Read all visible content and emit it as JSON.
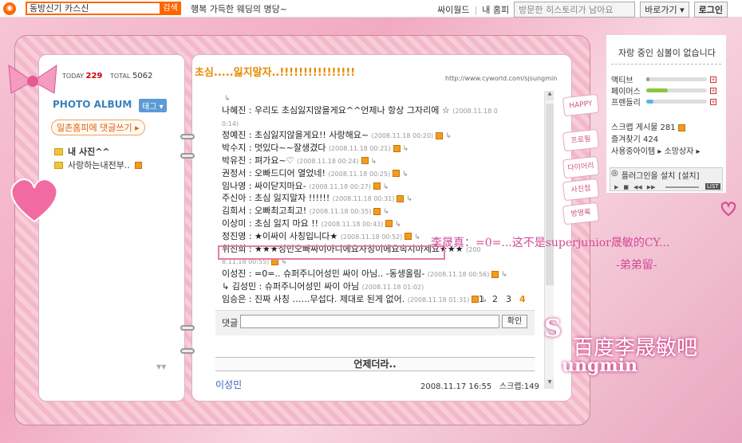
{
  "topbar": {
    "search_value": "동방신기 카스신",
    "search_button": "검색",
    "ticker": "행복 가득한 웨딩의 명당~",
    "links": [
      "싸이월드",
      "내 홈피"
    ],
    "history_placeholder": "방문한 히스토리가 남아요",
    "shortcut": "바로가기 ▾",
    "login": "로그인"
  },
  "counter": {
    "today_label": "TODAY",
    "today": "229",
    "total_label": "TOTAL",
    "total": "5062"
  },
  "left": {
    "album_title": "PHOTO ALBUM",
    "tag_button": "태그 ▾",
    "ilchon_link": "일촌홈피에 댓글쓰기 ▸",
    "folders": [
      "내 사진^^",
      "사랑하는내전부.."
    ]
  },
  "post": {
    "title": "초심.....잃지말자..!!!!!!!!!!!!!!!!",
    "url": "http://www.cyworld.com/sjsungmin",
    "comments": [
      {
        "text": "",
        "date": "",
        "reply": "↳"
      },
      {
        "text": "나혜진 : 우리도 초심잃지않을게요^^언제나 항상 그자리에 ☆",
        "date": "(2008.11.18 0",
        "reply": ""
      },
      {
        "text": "",
        "date": "0:14)",
        "reply": ""
      },
      {
        "text": "정예진 : 초심잃지않을게요!! 사랑해요~",
        "date": "(2008.11.18 00:20)",
        "reply": "↳"
      },
      {
        "text": "박수지 : 멋있다~~잘생겼다",
        "date": "(2008.11.18 00:21)",
        "reply": "↳"
      },
      {
        "text": "박유진 : 펴가요~♡",
        "date": "(2008.11.18 00:24)",
        "reply": "↳"
      },
      {
        "text": "권정서 : 오빠드디어 열었네!",
        "date": "(2008.11.18 00:25)",
        "reply": "↳"
      },
      {
        "text": "임나영 : 싸이닫지마요-",
        "date": "(2008.11.18 00:27)",
        "reply": "↳"
      },
      {
        "text": "주신아 : 초심 잃지말자 !!!!!!",
        "date": "(2008.11.18 00:31)",
        "reply": "↳"
      },
      {
        "text": "김희서 : 오빠최고최고!",
        "date": "(2008.11.18 00:35)",
        "reply": "↳"
      },
      {
        "text": "이상미 : 초심 잃지 마요 !!",
        "date": "(2008.11.18 00:43)",
        "reply": "↳"
      },
      {
        "text": "정진영 : ★이싸이 사칭입니다★",
        "date": "(2008.11.18 00:52)",
        "reply": "↳"
      },
      {
        "text": "위진희 : ★★★성민오빠싸이아니에요사칭이에요속지마세요★★★",
        "date": "(200",
        "reply": ""
      },
      {
        "text": "",
        "date": "8.11.18 00:55)",
        "reply": "↳"
      },
      {
        "text": "이성진 : =0=.. 슈퍼주니어성민 싸이 아님.. -동생올림-",
        "date": "(2008.11.18 00:56)",
        "reply": "↳"
      },
      {
        "text": "    ↳ 김성민 : 슈퍼주니어성민 싸이 아님",
        "date": "(2008.11.18 01:02)",
        "reply": ""
      },
      {
        "text": "임승은 : 진짜 사칭 ……무섭다. 제대로 된게 없어.",
        "date": "(2008.11.18 01:31)",
        "reply": "↳"
      }
    ],
    "pages": [
      "1",
      "2",
      "3",
      "4"
    ],
    "current_page": "4",
    "reply_label": "댓글",
    "reply_button": "확인",
    "section_title": "언제더라..",
    "author": "이성민",
    "meta_date": "2008.11.17 16:55",
    "scrap": "스크랩:149"
  },
  "side_tabs": [
    "HAPPY",
    "프로필",
    "다이어리",
    "사진첩",
    "방명록"
  ],
  "sidebar": {
    "title": "자랑 중인 심볼이 없습니다",
    "meters": [
      {
        "label": "액티브",
        "value": 0.05,
        "color": "#999999"
      },
      {
        "label": "페이머스",
        "value": 0.35,
        "color": "#8ec63f"
      },
      {
        "label": "프렌들리",
        "value": 0.12,
        "color": "#5ab4e6"
      }
    ],
    "scrap_count": "스크랩 게시물 281",
    "favorite": "즐겨찾기 424",
    "items": "사용중아이템 ▸ 소망상자 ▸",
    "player": "플러그인을 설치",
    "install": "[설치]",
    "list": "LIST"
  },
  "overlay": {
    "line1": "李晟真：=0=...这不是superjunior晟敏的CY...",
    "line2": "-弟弟留-",
    "watermark1": "百度李晟敏吧",
    "watermark_a": "S",
    "watermark_b": "ungmin"
  },
  "colors": {
    "accent": "#ff6600",
    "pink": "#d24a96"
  }
}
